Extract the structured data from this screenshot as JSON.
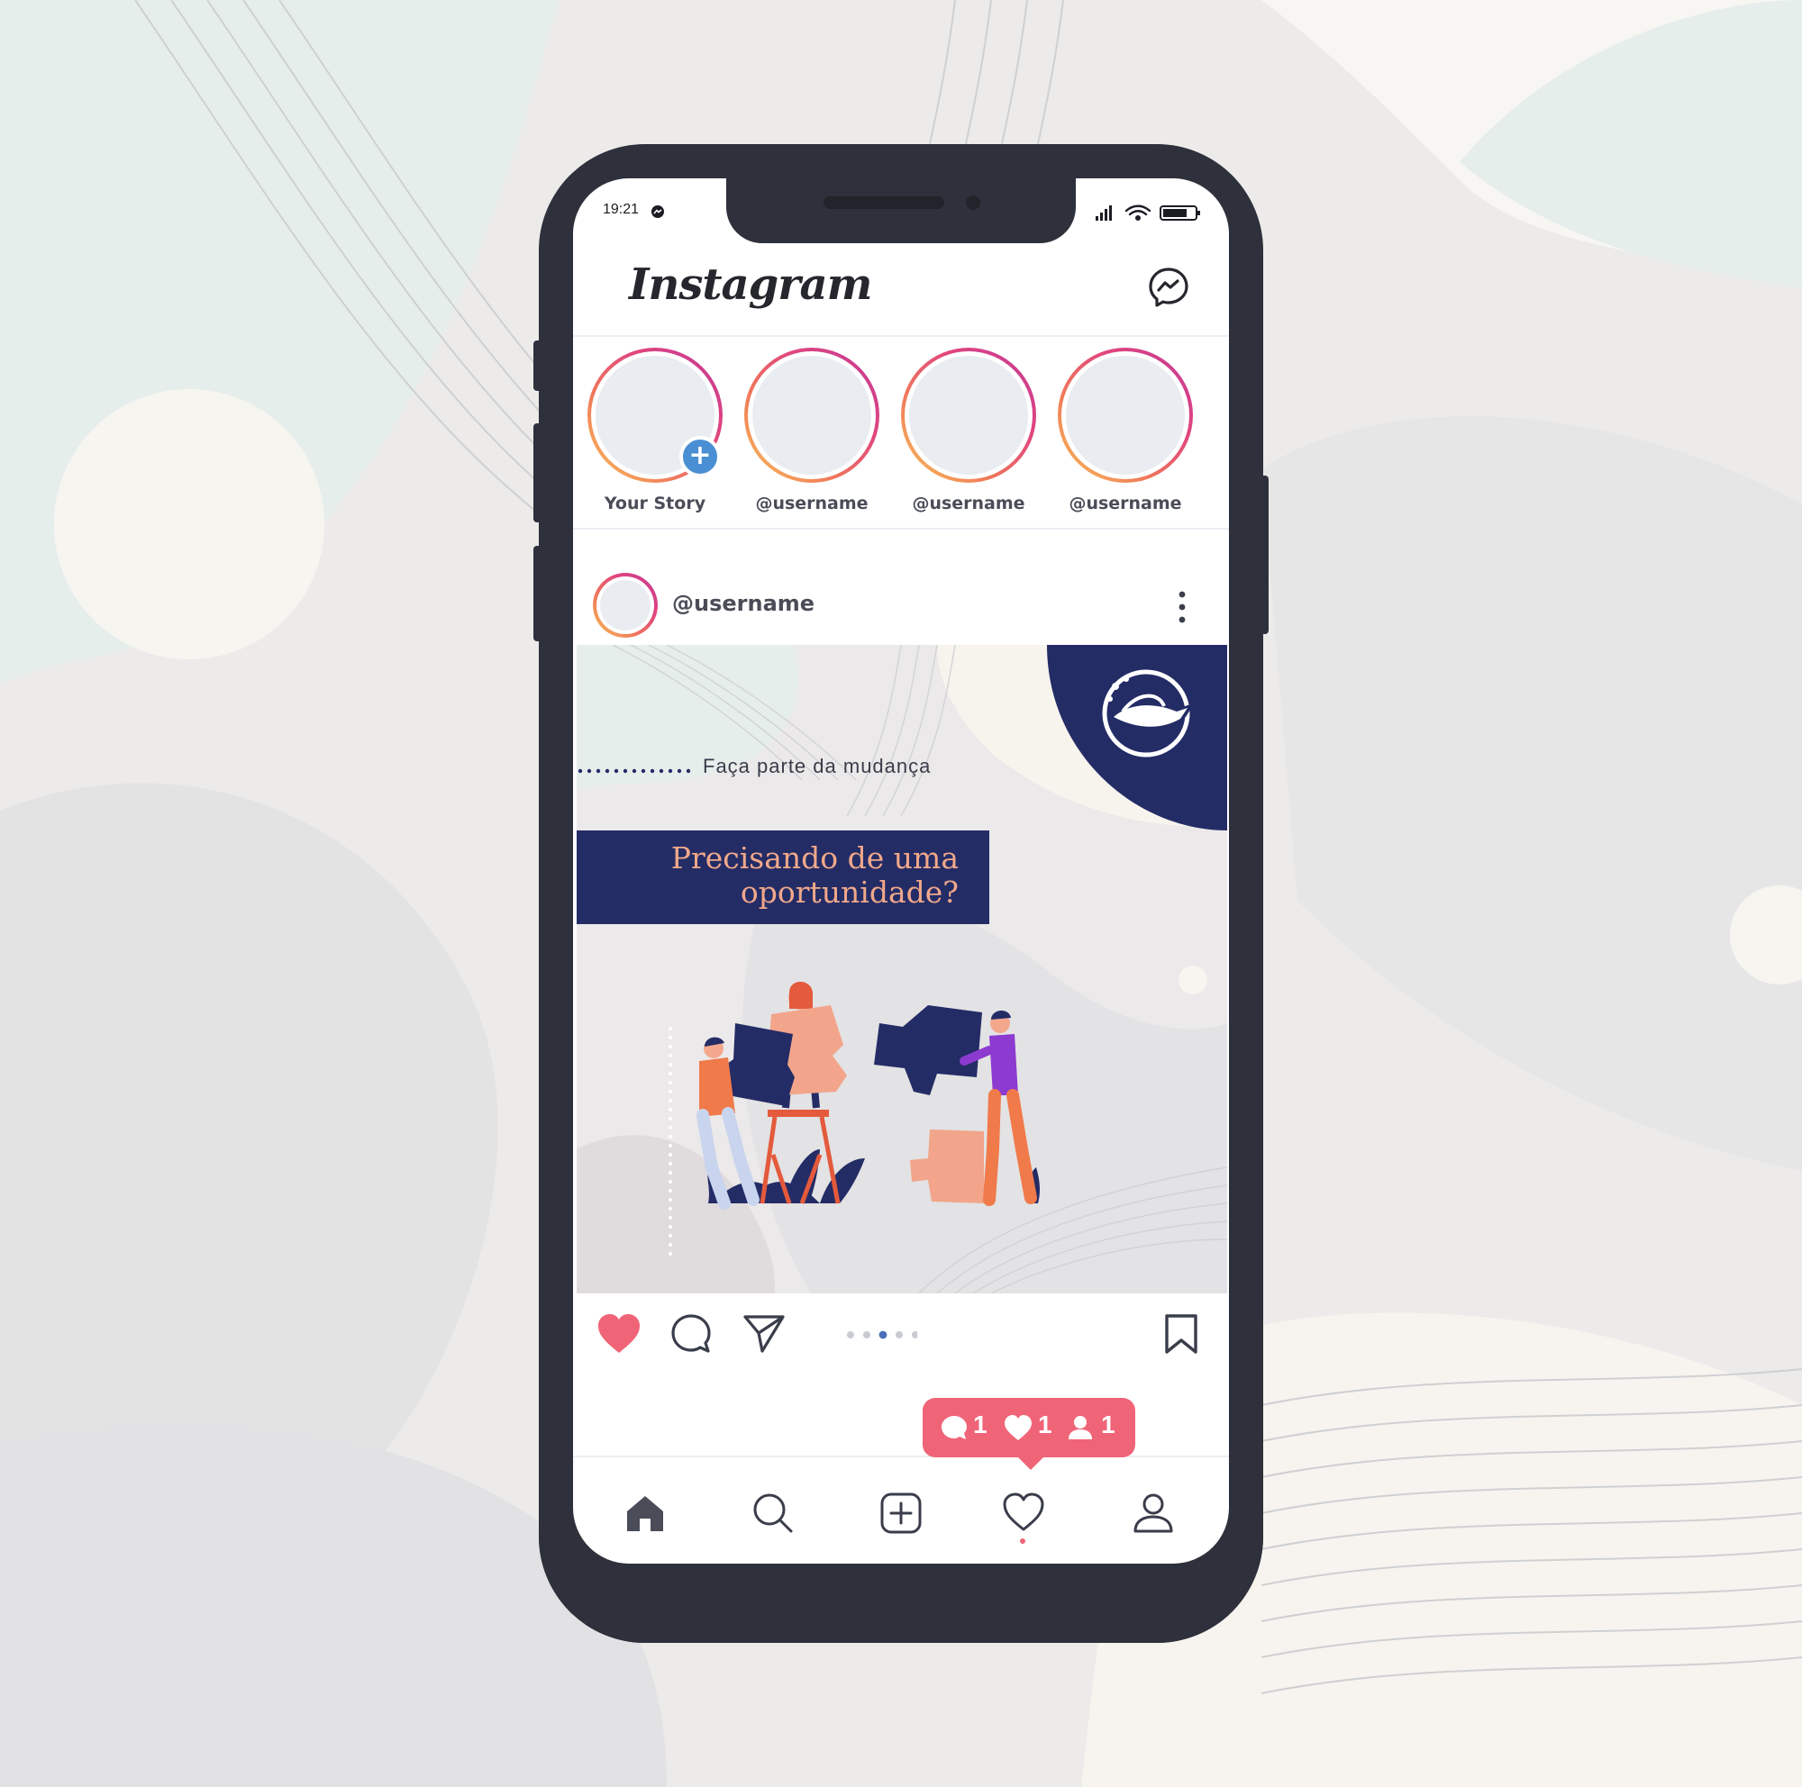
{
  "status_bar": {
    "time": "19:21"
  },
  "header": {
    "logo": "Instagram",
    "dm_icon": "messenger-icon"
  },
  "stories": [
    {
      "label": "Your Story",
      "own": true
    },
    {
      "label": "@username"
    },
    {
      "label": "@username"
    },
    {
      "label": "@username"
    }
  ],
  "post": {
    "username": "@username",
    "image": {
      "tagline": "Faça parte da mudança",
      "headline": "Precisando de uma\noportunidade?"
    },
    "carousel": {
      "count": 5,
      "active_index": 2
    }
  },
  "notification_badge": {
    "comments": "1",
    "likes": "1",
    "follows": "1"
  },
  "tabbar": [
    {
      "name": "home",
      "icon": "home-icon",
      "active": true
    },
    {
      "name": "search",
      "icon": "search-icon"
    },
    {
      "name": "new-post",
      "icon": "plus-square-icon"
    },
    {
      "name": "activity",
      "icon": "heart-icon"
    },
    {
      "name": "profile",
      "icon": "user-icon"
    }
  ],
  "colors": {
    "accent_pink": "#f06478",
    "navy": "#242c66",
    "peach": "#f0a88a",
    "phone_frame": "#2e313b",
    "story_add_blue": "#4a8fd3"
  }
}
